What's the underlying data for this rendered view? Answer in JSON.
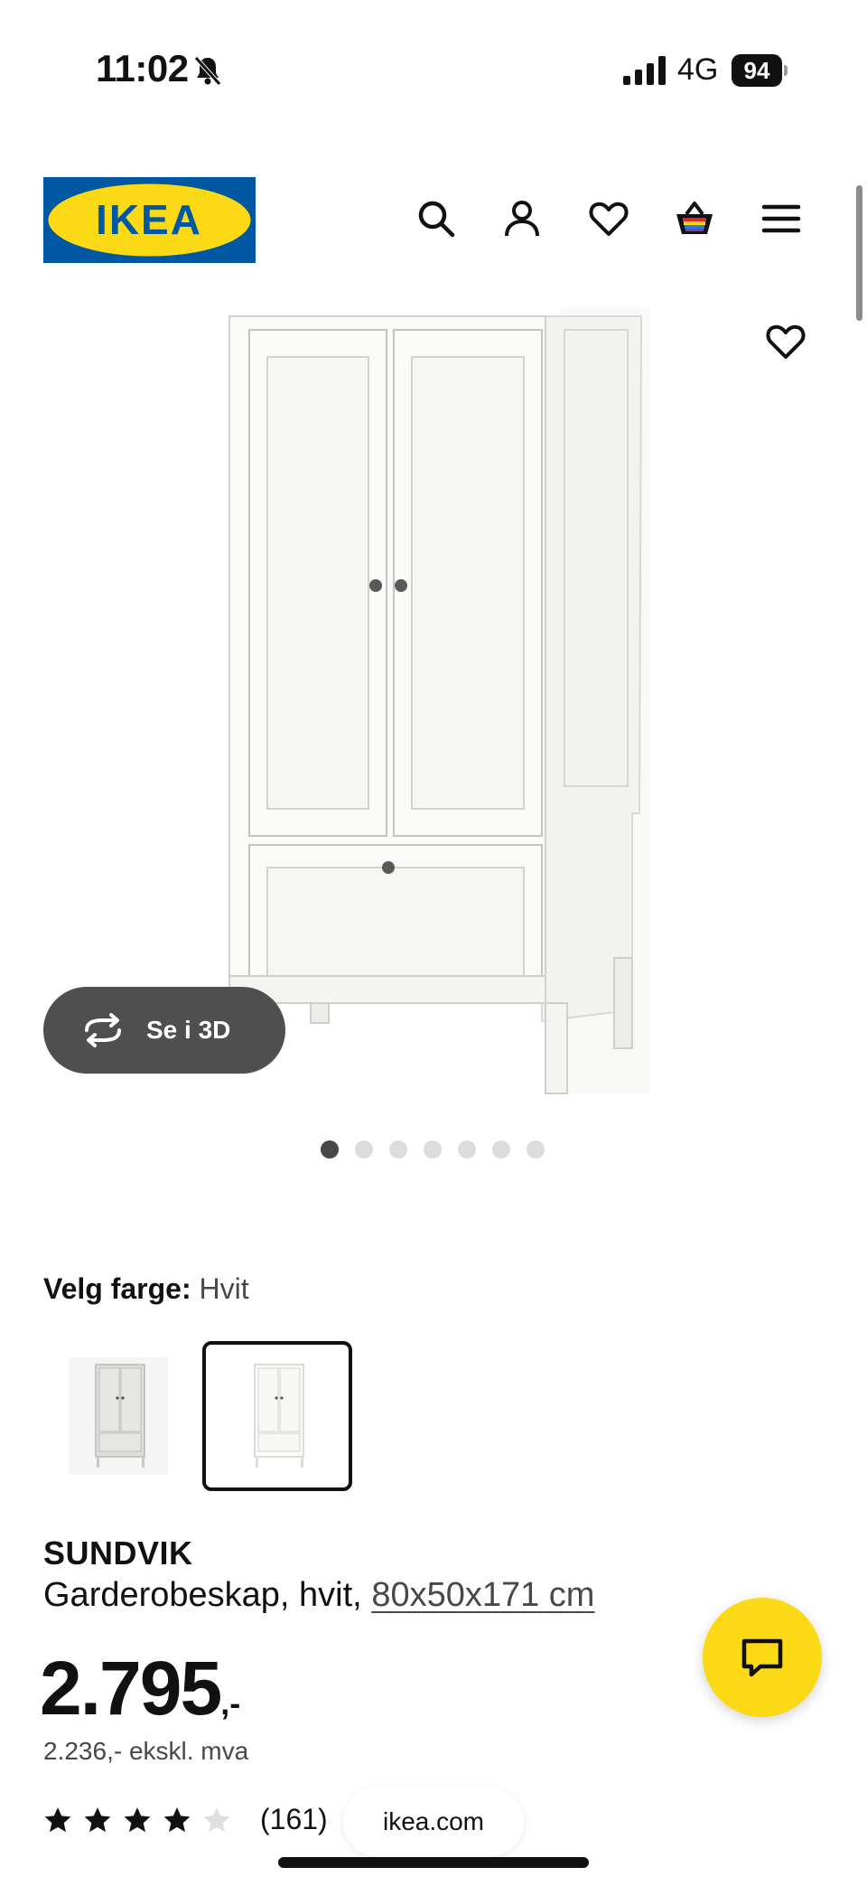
{
  "status_bar": {
    "time": "11:02",
    "network": "4G",
    "battery": "94",
    "icons": [
      "bell-slash-icon",
      "signal-bars-icon",
      "battery-icon"
    ]
  },
  "header": {
    "logo_text": "IKEA",
    "icons": [
      "search-icon",
      "account-icon",
      "heart-icon",
      "basket-icon",
      "menu-icon"
    ]
  },
  "gallery": {
    "view_3d_label": "Se i 3D",
    "dot_count": 7,
    "active_dot": 1
  },
  "color_selection": {
    "label": "Velg farge:",
    "value": "Hvit",
    "options": [
      {
        "name": "Grå",
        "selected": false
      },
      {
        "name": "Hvit",
        "selected": true
      }
    ]
  },
  "product": {
    "name": "SUNDVIK",
    "description": "Garderobeskap, hvit, ",
    "dimensions": "80x50x171 cm",
    "price": "2.795",
    "price_suffix": ",-",
    "price_ex_vat": "2.236,- ekskl. mva",
    "rating_stars": 4,
    "rating_max": 5,
    "review_count": "(161)"
  },
  "browser": {
    "url": "ikea.com"
  },
  "colors": {
    "ikea_blue": "#0058a3",
    "ikea_yellow": "#fbd914",
    "button_dark": "#4f4f4f"
  }
}
